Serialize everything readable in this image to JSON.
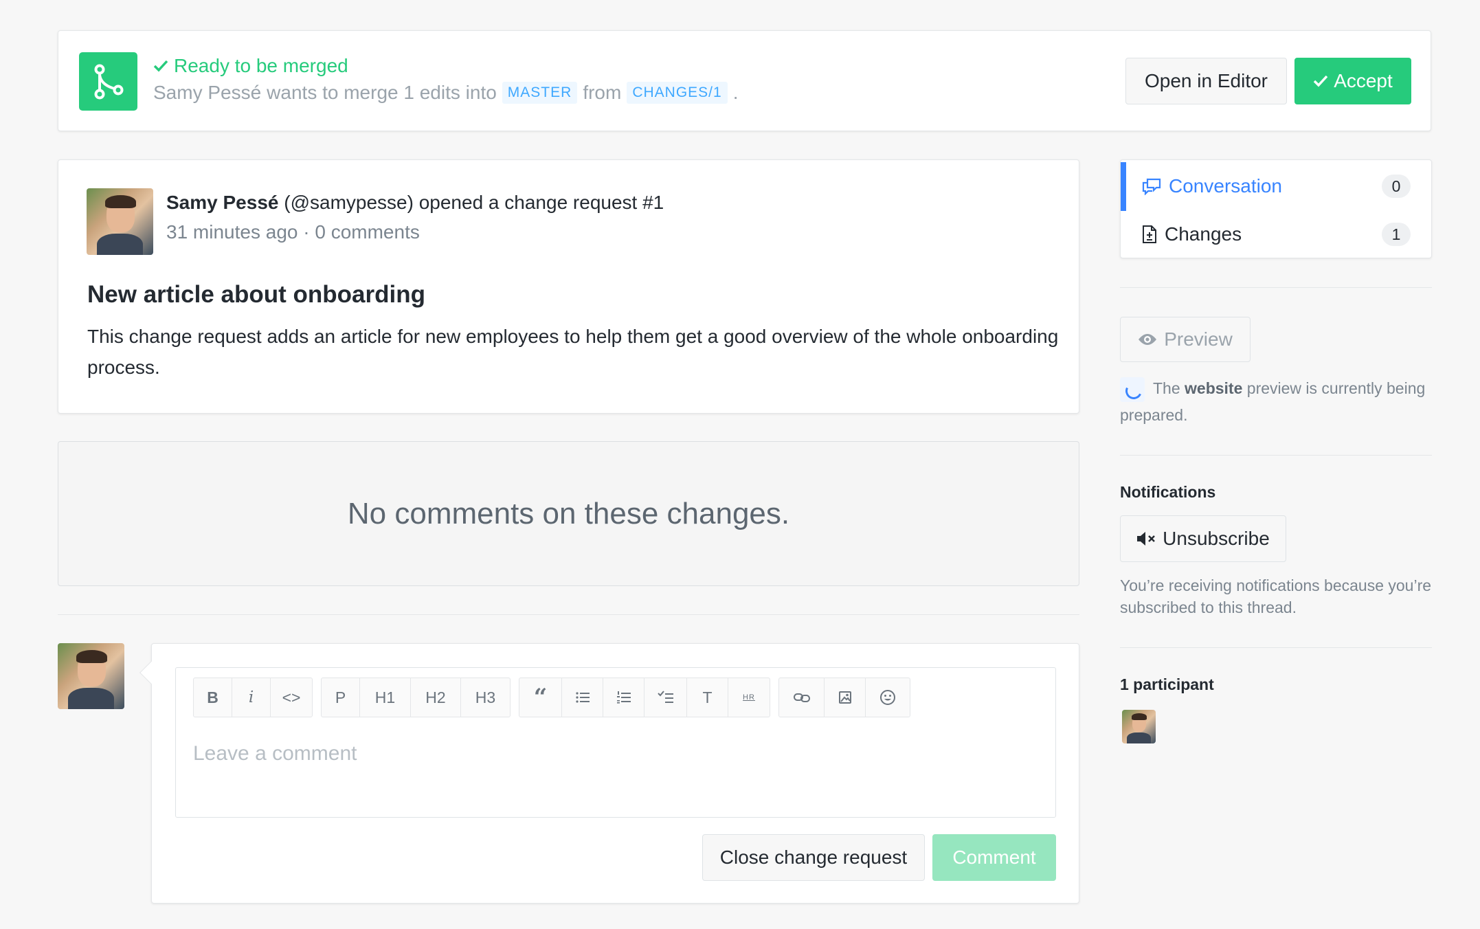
{
  "merge_banner": {
    "status": "Ready to be merged",
    "author": "Samy Pessé",
    "wants_to_merge_text": "wants to merge 1 edits into",
    "target_branch": "MASTER",
    "from_text": "from",
    "source_branch": "CHANGES/1",
    "period": ".",
    "open_in_editor_label": "Open in Editor",
    "accept_label": "Accept"
  },
  "change_request": {
    "author_name": "Samy Pessé",
    "author_handle": "(@samypesse)",
    "action_text": "opened a change request #1",
    "time_ago": "31 minutes ago",
    "separator": "·",
    "comments_count_text": "0 comments",
    "title": "New article about onboarding",
    "description": "This change request adds an article for new employees to help them get a good overview of the whole onboarding process."
  },
  "no_comments": {
    "text": "No comments on these changes."
  },
  "comment_editor": {
    "toolbar": {
      "group1": [
        "B",
        "i",
        "<>"
      ],
      "group2": [
        "P",
        "H1",
        "H2",
        "H3"
      ],
      "hr_label": "HR",
      "t_label": "T"
    },
    "placeholder": "Leave a comment",
    "close_label": "Close change request",
    "comment_label": "Comment"
  },
  "sidebar": {
    "tabs": [
      {
        "label": "Conversation",
        "count": "0",
        "active": true
      },
      {
        "label": "Changes",
        "count": "1",
        "active": false
      }
    ],
    "preview": {
      "button_label": "Preview",
      "status_prefix": "The",
      "status_bold": "website",
      "status_suffix": "preview is currently being prepared."
    },
    "notifications": {
      "heading": "Notifications",
      "unsubscribe_label": "Unsubscribe",
      "reason": "You’re receiving notifications because you’re subscribed to this thread."
    },
    "participants": {
      "heading": "1 participant"
    }
  },
  "colors": {
    "accent_green": "#26cb7c",
    "accent_blue": "#3884ff",
    "branch_blue": "#3ea8ff",
    "muted_text": "#9aa3ab"
  }
}
